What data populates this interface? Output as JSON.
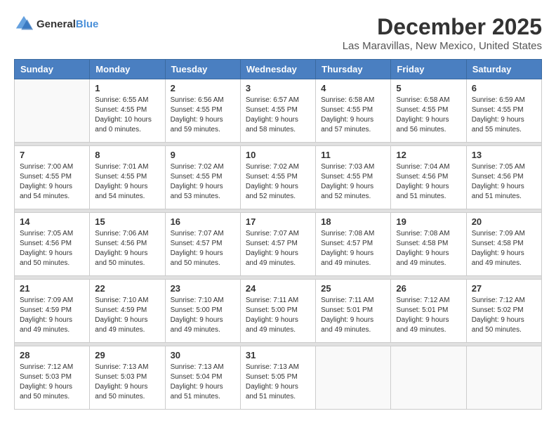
{
  "logo": {
    "general": "General",
    "blue": "Blue"
  },
  "title": {
    "month": "December 2025",
    "location": "Las Maravillas, New Mexico, United States"
  },
  "headers": [
    "Sunday",
    "Monday",
    "Tuesday",
    "Wednesday",
    "Thursday",
    "Friday",
    "Saturday"
  ],
  "weeks": [
    [
      {
        "day": "",
        "sunrise": "",
        "sunset": "",
        "daylight": ""
      },
      {
        "day": "1",
        "sunrise": "Sunrise: 6:55 AM",
        "sunset": "Sunset: 4:55 PM",
        "daylight": "Daylight: 10 hours and 0 minutes."
      },
      {
        "day": "2",
        "sunrise": "Sunrise: 6:56 AM",
        "sunset": "Sunset: 4:55 PM",
        "daylight": "Daylight: 9 hours and 59 minutes."
      },
      {
        "day": "3",
        "sunrise": "Sunrise: 6:57 AM",
        "sunset": "Sunset: 4:55 PM",
        "daylight": "Daylight: 9 hours and 58 minutes."
      },
      {
        "day": "4",
        "sunrise": "Sunrise: 6:58 AM",
        "sunset": "Sunset: 4:55 PM",
        "daylight": "Daylight: 9 hours and 57 minutes."
      },
      {
        "day": "5",
        "sunrise": "Sunrise: 6:58 AM",
        "sunset": "Sunset: 4:55 PM",
        "daylight": "Daylight: 9 hours and 56 minutes."
      },
      {
        "day": "6",
        "sunrise": "Sunrise: 6:59 AM",
        "sunset": "Sunset: 4:55 PM",
        "daylight": "Daylight: 9 hours and 55 minutes."
      }
    ],
    [
      {
        "day": "7",
        "sunrise": "Sunrise: 7:00 AM",
        "sunset": "Sunset: 4:55 PM",
        "daylight": "Daylight: 9 hours and 54 minutes."
      },
      {
        "day": "8",
        "sunrise": "Sunrise: 7:01 AM",
        "sunset": "Sunset: 4:55 PM",
        "daylight": "Daylight: 9 hours and 54 minutes."
      },
      {
        "day": "9",
        "sunrise": "Sunrise: 7:02 AM",
        "sunset": "Sunset: 4:55 PM",
        "daylight": "Daylight: 9 hours and 53 minutes."
      },
      {
        "day": "10",
        "sunrise": "Sunrise: 7:02 AM",
        "sunset": "Sunset: 4:55 PM",
        "daylight": "Daylight: 9 hours and 52 minutes."
      },
      {
        "day": "11",
        "sunrise": "Sunrise: 7:03 AM",
        "sunset": "Sunset: 4:55 PM",
        "daylight": "Daylight: 9 hours and 52 minutes."
      },
      {
        "day": "12",
        "sunrise": "Sunrise: 7:04 AM",
        "sunset": "Sunset: 4:56 PM",
        "daylight": "Daylight: 9 hours and 51 minutes."
      },
      {
        "day": "13",
        "sunrise": "Sunrise: 7:05 AM",
        "sunset": "Sunset: 4:56 PM",
        "daylight": "Daylight: 9 hours and 51 minutes."
      }
    ],
    [
      {
        "day": "14",
        "sunrise": "Sunrise: 7:05 AM",
        "sunset": "Sunset: 4:56 PM",
        "daylight": "Daylight: 9 hours and 50 minutes."
      },
      {
        "day": "15",
        "sunrise": "Sunrise: 7:06 AM",
        "sunset": "Sunset: 4:56 PM",
        "daylight": "Daylight: 9 hours and 50 minutes."
      },
      {
        "day": "16",
        "sunrise": "Sunrise: 7:07 AM",
        "sunset": "Sunset: 4:57 PM",
        "daylight": "Daylight: 9 hours and 50 minutes."
      },
      {
        "day": "17",
        "sunrise": "Sunrise: 7:07 AM",
        "sunset": "Sunset: 4:57 PM",
        "daylight": "Daylight: 9 hours and 49 minutes."
      },
      {
        "day": "18",
        "sunrise": "Sunrise: 7:08 AM",
        "sunset": "Sunset: 4:57 PM",
        "daylight": "Daylight: 9 hours and 49 minutes."
      },
      {
        "day": "19",
        "sunrise": "Sunrise: 7:08 AM",
        "sunset": "Sunset: 4:58 PM",
        "daylight": "Daylight: 9 hours and 49 minutes."
      },
      {
        "day": "20",
        "sunrise": "Sunrise: 7:09 AM",
        "sunset": "Sunset: 4:58 PM",
        "daylight": "Daylight: 9 hours and 49 minutes."
      }
    ],
    [
      {
        "day": "21",
        "sunrise": "Sunrise: 7:09 AM",
        "sunset": "Sunset: 4:59 PM",
        "daylight": "Daylight: 9 hours and 49 minutes."
      },
      {
        "day": "22",
        "sunrise": "Sunrise: 7:10 AM",
        "sunset": "Sunset: 4:59 PM",
        "daylight": "Daylight: 9 hours and 49 minutes."
      },
      {
        "day": "23",
        "sunrise": "Sunrise: 7:10 AM",
        "sunset": "Sunset: 5:00 PM",
        "daylight": "Daylight: 9 hours and 49 minutes."
      },
      {
        "day": "24",
        "sunrise": "Sunrise: 7:11 AM",
        "sunset": "Sunset: 5:00 PM",
        "daylight": "Daylight: 9 hours and 49 minutes."
      },
      {
        "day": "25",
        "sunrise": "Sunrise: 7:11 AM",
        "sunset": "Sunset: 5:01 PM",
        "daylight": "Daylight: 9 hours and 49 minutes."
      },
      {
        "day": "26",
        "sunrise": "Sunrise: 7:12 AM",
        "sunset": "Sunset: 5:01 PM",
        "daylight": "Daylight: 9 hours and 49 minutes."
      },
      {
        "day": "27",
        "sunrise": "Sunrise: 7:12 AM",
        "sunset": "Sunset: 5:02 PM",
        "daylight": "Daylight: 9 hours and 50 minutes."
      }
    ],
    [
      {
        "day": "28",
        "sunrise": "Sunrise: 7:12 AM",
        "sunset": "Sunset: 5:03 PM",
        "daylight": "Daylight: 9 hours and 50 minutes."
      },
      {
        "day": "29",
        "sunrise": "Sunrise: 7:13 AM",
        "sunset": "Sunset: 5:03 PM",
        "daylight": "Daylight: 9 hours and 50 minutes."
      },
      {
        "day": "30",
        "sunrise": "Sunrise: 7:13 AM",
        "sunset": "Sunset: 5:04 PM",
        "daylight": "Daylight: 9 hours and 51 minutes."
      },
      {
        "day": "31",
        "sunrise": "Sunrise: 7:13 AM",
        "sunset": "Sunset: 5:05 PM",
        "daylight": "Daylight: 9 hours and 51 minutes."
      },
      {
        "day": "",
        "sunrise": "",
        "sunset": "",
        "daylight": ""
      },
      {
        "day": "",
        "sunrise": "",
        "sunset": "",
        "daylight": ""
      },
      {
        "day": "",
        "sunrise": "",
        "sunset": "",
        "daylight": ""
      }
    ]
  ]
}
